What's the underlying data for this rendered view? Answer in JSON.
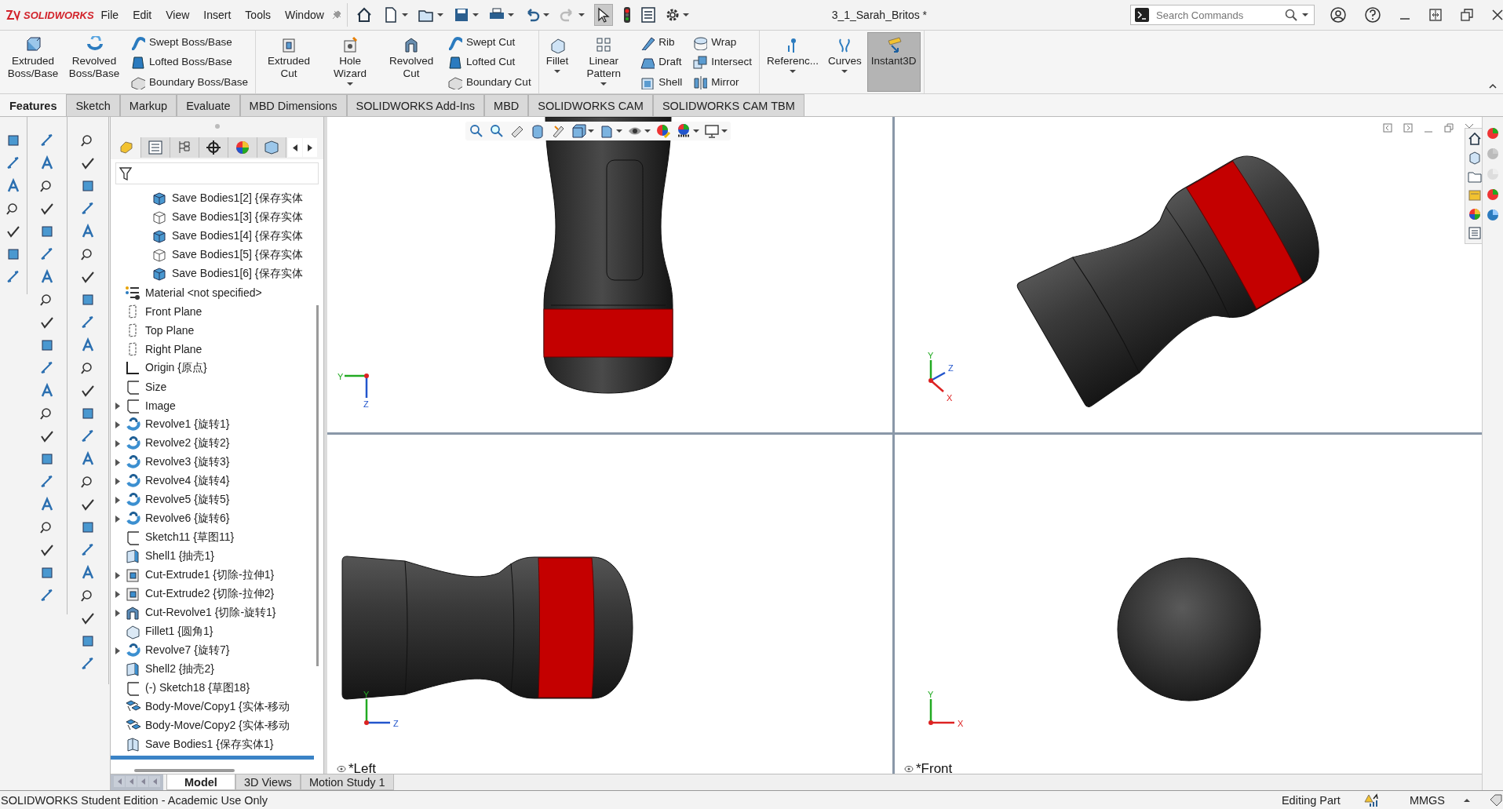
{
  "title_bar": {
    "logo": "SOLIDWORKS",
    "menus": [
      "File",
      "Edit",
      "View",
      "Insert",
      "Tools",
      "Window"
    ],
    "select_pressed": true,
    "document_title": "3_1_Sarah_Britos *",
    "search": {
      "placeholder": "Search Commands"
    }
  },
  "ribbon": {
    "groups": [
      {
        "items": [
          {
            "kind": "large",
            "label": "Extruded Boss/Base",
            "dropdown": false,
            "pressed": false
          },
          {
            "kind": "large",
            "label": "Revolved Boss/Base",
            "dropdown": false,
            "pressed": false
          },
          {
            "kind": "stack",
            "entries": [
              "Swept Boss/Base",
              "Lofted Boss/Base",
              "Boundary Boss/Base"
            ]
          }
        ]
      },
      {
        "items": [
          {
            "kind": "large",
            "label": "Extruded Cut",
            "dropdown": false,
            "pressed": false
          },
          {
            "kind": "large",
            "label": "Hole Wizard",
            "dropdown": true,
            "pressed": false
          },
          {
            "kind": "large",
            "label": "Revolved Cut",
            "dropdown": false,
            "pressed": false
          },
          {
            "kind": "stack",
            "entries": [
              "Swept Cut",
              "Lofted Cut",
              "Boundary Cut"
            ]
          }
        ]
      },
      {
        "items": [
          {
            "kind": "large",
            "label": "Fillet",
            "dropdown": true,
            "pressed": false
          },
          {
            "kind": "large",
            "label": "Linear Pattern",
            "dropdown": true,
            "pressed": false
          },
          {
            "kind": "stack",
            "entries": [
              "Rib",
              "Draft",
              "Shell"
            ]
          },
          {
            "kind": "stack",
            "entries": [
              "Wrap",
              "Intersect",
              "Mirror"
            ]
          }
        ]
      },
      {
        "items": [
          {
            "kind": "large",
            "label": "Referenc...",
            "dropdown": true,
            "pressed": false
          },
          {
            "kind": "large",
            "label": "Curves",
            "dropdown": true,
            "pressed": false
          },
          {
            "kind": "large",
            "label": "Instant3D",
            "dropdown": false,
            "pressed": true
          }
        ]
      }
    ]
  },
  "tabs": [
    {
      "label": "Features",
      "selected": true
    },
    {
      "label": "Sketch",
      "selected": false
    },
    {
      "label": "Markup",
      "selected": false
    },
    {
      "label": "Evaluate",
      "selected": false
    },
    {
      "label": "MBD Dimensions",
      "selected": false
    },
    {
      "label": "SOLIDWORKS Add-Ins",
      "selected": false
    },
    {
      "label": "MBD",
      "selected": false
    },
    {
      "label": "SOLIDWORKS CAM",
      "selected": false
    },
    {
      "label": "SOLIDWORKS CAM TBM",
      "selected": false
    }
  ],
  "tree": {
    "panel_tabs": [
      {
        "selected": true
      },
      {
        "selected": false
      },
      {
        "selected": false
      },
      {
        "selected": false
      },
      {
        "selected": false
      },
      {
        "selected": false
      }
    ],
    "continued_children": [
      {
        "kind": "body-solid",
        "label": "Save Bodies1[2] {保存实体"
      },
      {
        "kind": "body-empty",
        "label": "Save Bodies1[3] {保存实体"
      },
      {
        "kind": "body-solid",
        "label": "Save Bodies1[4] {保存实体"
      },
      {
        "kind": "body-empty",
        "label": "Save Bodies1[5] {保存实体"
      },
      {
        "kind": "body-solid",
        "label": "Save Bodies1[6] {保存实体"
      }
    ],
    "items": [
      {
        "kind": "material",
        "label": "Material <not specified>",
        "expandable": false
      },
      {
        "kind": "plane",
        "label": "Front Plane",
        "expandable": false
      },
      {
        "kind": "plane",
        "label": "Top Plane",
        "expandable": false
      },
      {
        "kind": "plane",
        "label": "Right Plane",
        "expandable": false
      },
      {
        "kind": "origin",
        "label": "Origin {原点}",
        "expandable": false
      },
      {
        "kind": "sketch",
        "label": "Size",
        "expandable": false
      },
      {
        "kind": "sketch",
        "label": "Image",
        "expandable": true
      },
      {
        "kind": "revolve",
        "label": "Revolve1 {旋转1}",
        "expandable": true
      },
      {
        "kind": "revolve",
        "label": "Revolve2 {旋转2}",
        "expandable": true
      },
      {
        "kind": "revolve",
        "label": "Revolve3 {旋转3}",
        "expandable": true
      },
      {
        "kind": "revolve",
        "label": "Revolve4 {旋转4}",
        "expandable": true
      },
      {
        "kind": "revolve",
        "label": "Revolve5 {旋转5}",
        "expandable": true
      },
      {
        "kind": "revolve",
        "label": "Revolve6 {旋转6}",
        "expandable": true
      },
      {
        "kind": "sketch",
        "label": "Sketch11 {草图11}",
        "expandable": false
      },
      {
        "kind": "shell",
        "label": "Shell1 {抽壳1}",
        "expandable": false
      },
      {
        "kind": "cut-extrude",
        "label": "Cut-Extrude1 {切除-拉伸1}",
        "expandable": true
      },
      {
        "kind": "cut-extrude",
        "label": "Cut-Extrude2 {切除-拉伸2}",
        "expandable": true
      },
      {
        "kind": "cut-revolve",
        "label": "Cut-Revolve1 {切除-旋转1}",
        "expandable": true
      },
      {
        "kind": "fillet",
        "label": "Fillet1 {圆角1}",
        "expandable": false
      },
      {
        "kind": "revolve",
        "label": "Revolve7 {旋转7}",
        "expandable": true
      },
      {
        "kind": "shell",
        "label": "Shell2 {抽壳2}",
        "expandable": false
      },
      {
        "kind": "sketch",
        "label": "(-) Sketch18 {草图18}",
        "expandable": false
      },
      {
        "kind": "move-copy",
        "label": "Body-Move/Copy1 {实体-移动",
        "expandable": false
      },
      {
        "kind": "move-copy",
        "label": "Body-Move/Copy2 {实体-移动",
        "expandable": false
      },
      {
        "kind": "save-bodies",
        "label": "Save Bodies1 {保存实体1}",
        "expandable": false
      }
    ]
  },
  "viewports": [
    {
      "kind": "top",
      "axes": [
        "Y",
        "Z"
      ]
    },
    {
      "kind": "isometric",
      "axes": [
        "Y",
        "Z",
        "X"
      ]
    },
    {
      "kind": "left",
      "label": "*Left",
      "axes": [
        "Y",
        "Z"
      ]
    },
    {
      "kind": "front",
      "label": "*Front",
      "axes": [
        "Y",
        "X"
      ]
    }
  ],
  "bottom_tabs": [
    {
      "label": "Model",
      "selected": true
    },
    {
      "label": "3D Views",
      "selected": false
    },
    {
      "label": "Motion Study 1",
      "selected": false
    }
  ],
  "status_bar": {
    "edition": "SOLIDWORKS Student Edition - Academic Use Only",
    "mode": "Editing Part",
    "units": "MMGS"
  }
}
